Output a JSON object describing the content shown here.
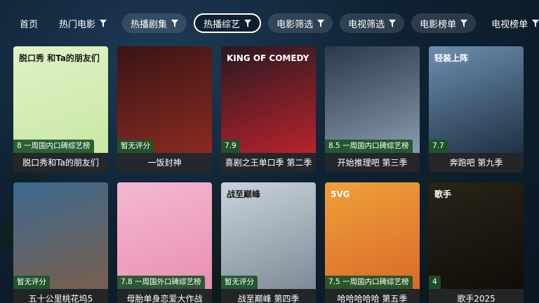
{
  "nav": {
    "items": [
      {
        "label": "首页",
        "filter": false,
        "active": false
      },
      {
        "label": "热门电影",
        "filter": true,
        "active": false
      },
      {
        "label": "热播剧集",
        "filter": true,
        "active": false
      },
      {
        "label": "热播综艺",
        "filter": true,
        "active": true
      },
      {
        "label": "电影筛选",
        "filter": true,
        "active": false
      },
      {
        "label": "电视筛选",
        "filter": true,
        "active": false
      },
      {
        "label": "电影榜单",
        "filter": true,
        "active": false
      },
      {
        "label": "电视榜单",
        "filter": true,
        "active": false
      }
    ]
  },
  "cards": [
    {
      "title": "脱口秀和Ta的朋友们",
      "badge": "8 一周国内口碑综艺榜",
      "poster_text": "脱口秀 和Ta的朋友们",
      "colors": [
        "#dff2c6",
        "#c9e7a5"
      ]
    },
    {
      "title": "一饭封神",
      "badge": "暂无评分",
      "poster_text": "",
      "colors": [
        "#3a1414",
        "#8a2b22"
      ]
    },
    {
      "title": "喜剧之王单口季 第二季",
      "badge": "7.9",
      "poster_text": "KING OF COMEDY",
      "colors": [
        "#2a1820",
        "#b7242c"
      ]
    },
    {
      "title": "开始推理吧 第三季",
      "badge": "8.5 一周国内口碑综艺榜",
      "poster_text": "",
      "colors": [
        "#2b3a4a",
        "#8a9bb0"
      ]
    },
    {
      "title": "奔跑吧 第九季",
      "badge": "7.7",
      "poster_text": "轻装上阵",
      "colors": [
        "#6d8fb0",
        "#203144"
      ]
    },
    {
      "title": "五十公里桃花坞5",
      "badge": "暂无评分",
      "poster_text": "",
      "colors": [
        "#3b6a8f",
        "#7a5e4c"
      ]
    },
    {
      "title": "母胎单身恋爱大作战",
      "badge": "7.8 一周国外口碑综艺榜",
      "poster_text": "",
      "colors": [
        "#f5b8d0",
        "#e98fb3"
      ]
    },
    {
      "title": "战至巅峰 第四季",
      "badge": "暂无评分",
      "poster_text": "战至巅峰",
      "colors": [
        "#c9d3dc",
        "#7e8b97"
      ]
    },
    {
      "title": "哈哈哈哈哈 第五季",
      "badge": "7.5 一周国内口碑综艺榜",
      "poster_text": "5VG",
      "colors": [
        "#f0a03a",
        "#d96a2a"
      ]
    },
    {
      "title": "歌手2025",
      "badge": "4",
      "poster_text": "歌手",
      "colors": [
        "#2a2418",
        "#0f0d08"
      ]
    }
  ]
}
